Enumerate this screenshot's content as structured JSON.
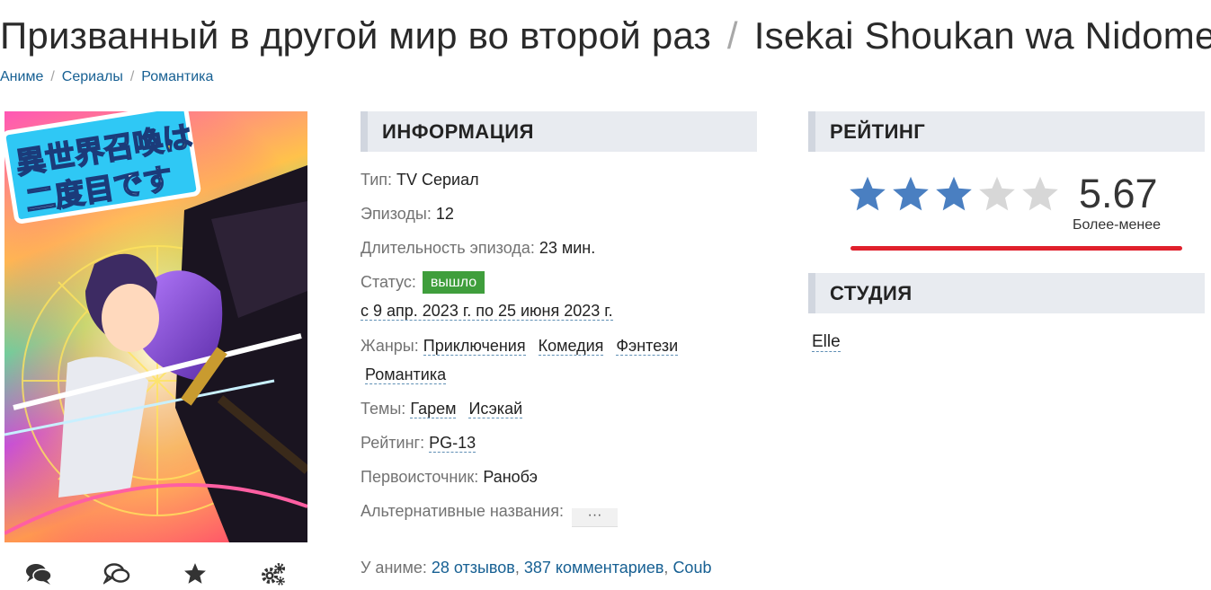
{
  "title": {
    "ru": "Призванный в другой мир во второй раз",
    "separator": "/",
    "romaji": "Isekai Shoukan wa Nidome desu"
  },
  "breadcrumb": [
    "Аниме",
    "Сериалы",
    "Романтика"
  ],
  "poster": {
    "logo_line1": "異世界召喚は",
    "logo_line2": "二度目です"
  },
  "poster_actions": [
    {
      "icon": "comments-icon"
    },
    {
      "icon": "comment-outline-icon"
    },
    {
      "icon": "star-icon"
    },
    {
      "icon": "gears-icon"
    }
  ],
  "info": {
    "header": "ИНФОРМАЦИЯ",
    "type_label": "Тип:",
    "type_value": "TV Сериал",
    "episodes_label": "Эпизоды:",
    "episodes_value": "12",
    "duration_label": "Длительность эпизода:",
    "duration_value": "23 мин.",
    "status_label": "Статус:",
    "status_badge": "вышло",
    "status_color": "#3f9e3c",
    "aired": "с 9 апр. 2023 г. по 25 июня 2023 г.",
    "genres_label": "Жанры:",
    "genres": [
      "Приключения",
      "Комедия",
      "Фэнтези",
      "Романтика"
    ],
    "themes_label": "Темы:",
    "themes": [
      "Гарем",
      "Исэкай"
    ],
    "rating_label": "Рейтинг:",
    "rating_value": "PG-13",
    "source_label": "Первоисточник:",
    "source_value": "Ранобэ",
    "alt_label": "Альтернативные названия:",
    "alt_button": "···",
    "about_label": "У аниме:",
    "about_reviews": "28 отзывов",
    "about_comments": "387 комментариев",
    "about_coub": "Coub",
    "comma": ","
  },
  "rating": {
    "header": "РЕЙТИНГ",
    "score": "5.67",
    "stars_filled": 3,
    "stars_total": 5,
    "verdict": "Более-менее",
    "star_color": "#4a7fc1",
    "star_empty_color": "#d7d7d7",
    "bar_color": "#e0202c"
  },
  "studio": {
    "header": "СТУДИЯ",
    "name": "Elle"
  }
}
